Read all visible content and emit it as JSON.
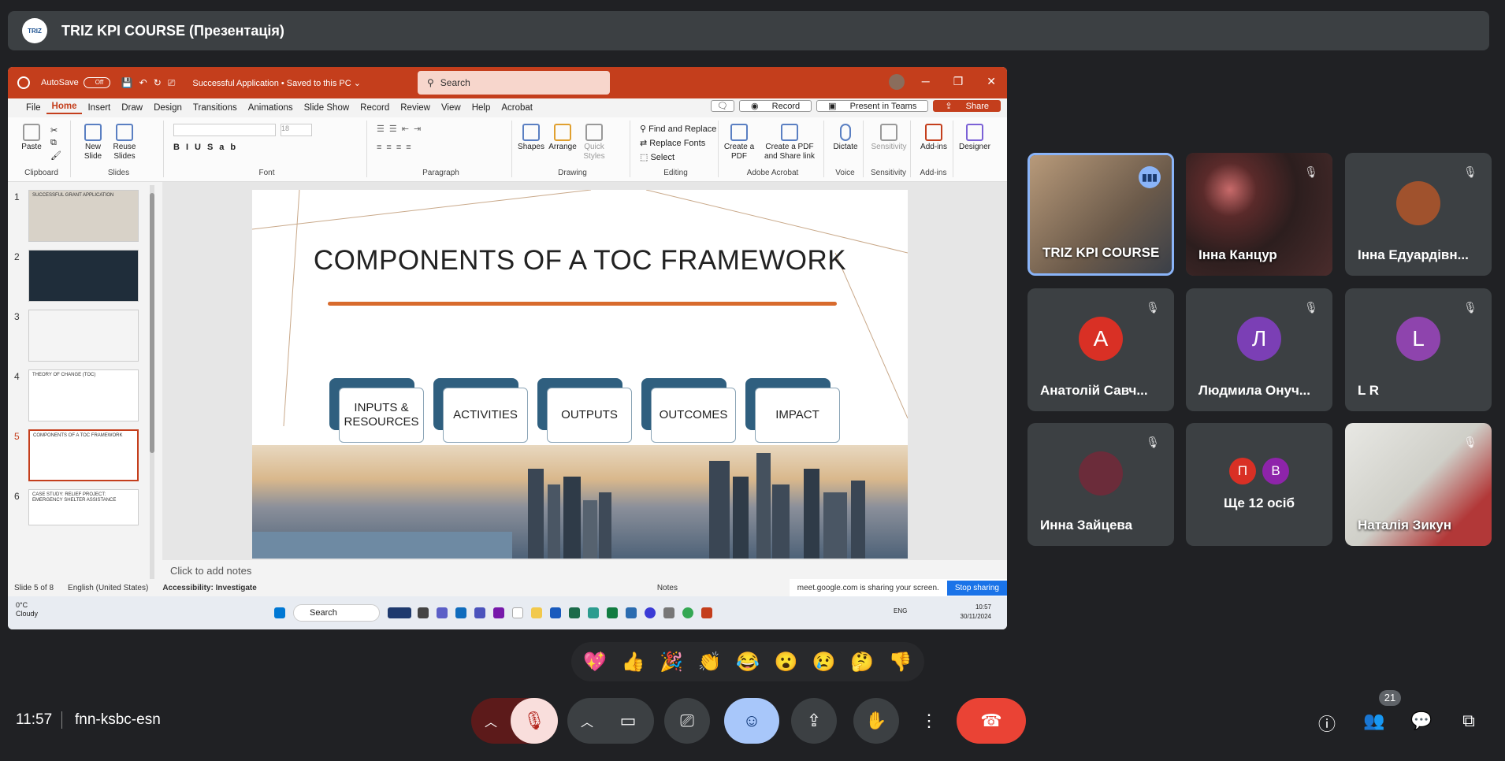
{
  "meeting": {
    "title": "TRIZ KPI COURSE (Презентація)",
    "logo_text": "TRIZ",
    "time": "11:57",
    "code": "fnn-ksbc-esn",
    "participant_count": "21"
  },
  "ppt": {
    "autosave_label": "AutoSave",
    "autosave_state": "Off",
    "doc_name": "Successful Application • Saved to this PC ⌄",
    "search_placeholder": "Search",
    "menu": [
      "File",
      "Home",
      "Insert",
      "Draw",
      "Design",
      "Transitions",
      "Animations",
      "Slide Show",
      "Record",
      "Review",
      "View",
      "Help",
      "Acrobat"
    ],
    "active_menu": "Home",
    "record_btn": "Record",
    "teams_btn": "Present in Teams",
    "share_btn": "Share",
    "ribbon": {
      "paste": "Paste",
      "clipboard": "Clipboard",
      "new_slide": "New Slide",
      "reuse_slides": "Reuse Slides",
      "slides": "Slides",
      "font": "Font",
      "paragraph": "Paragraph",
      "shapes": "Shapes",
      "arrange": "Arrange",
      "quick_styles": "Quick Styles",
      "drawing": "Drawing",
      "find_replace": "Find and Replace",
      "replace_fonts": "Replace Fonts",
      "select": "Select",
      "editing": "Editing",
      "create_pdf": "Create a PDF",
      "create_pdf_share": "Create a PDF and Share link",
      "adobe_acrobat": "Adobe Acrobat",
      "dictate": "Dictate",
      "voice": "Voice",
      "sensitivity_btn": "Sensitivity",
      "sensitivity": "Sensitivity",
      "addins_btn": "Add-ins",
      "addins": "Add-ins",
      "designer": "Designer"
    },
    "thumbnails": [
      {
        "num": "1",
        "text": "SUCCESSFUL GRANT APPLICATION"
      },
      {
        "num": "2",
        "text": ""
      },
      {
        "num": "3",
        "text": ""
      },
      {
        "num": "4",
        "text": "THEORY OF CHANGE (TOC)"
      },
      {
        "num": "5",
        "text": "COMPONENTS OF A TOC FRAMEWORK"
      },
      {
        "num": "6",
        "text": "CASE STUDY: RELIEF PROJECT: EMERGENCY SHELTER ASSISTANCE"
      }
    ],
    "selected_slide": "5",
    "slide": {
      "title": "COMPONENTS OF A TOC FRAMEWORK",
      "boxes": [
        "INPUTS & RESOURCES",
        "ACTIVITIES",
        "OUTPUTS",
        "OUTCOMES",
        "IMPACT"
      ]
    },
    "notes_placeholder": "Click to add notes",
    "status": {
      "slide_pos": "Slide 5 of 8",
      "language": "English (United States)",
      "accessibility": "Accessibility: Investigate",
      "notes": "Notes"
    },
    "sharing_text": "meet.google.com is sharing your screen.",
    "stop_sharing": "Stop sharing",
    "taskbar": {
      "weather_temp": "0°C",
      "weather_desc": "Cloudy",
      "search": "Search",
      "lang": "ENG",
      "time": "10:57",
      "date": "30/11/2024"
    }
  },
  "participants": [
    {
      "name": "TRIZ KPI COURSE",
      "type": "video",
      "speaking": true
    },
    {
      "name": "Інна Канцур",
      "type": "video",
      "muted": true
    },
    {
      "name": "Інна Едуардівн...",
      "type": "photo",
      "muted": true
    },
    {
      "name": "Анатолій Савч...",
      "type": "letter",
      "letter": "А",
      "color": "#d93025",
      "muted": true
    },
    {
      "name": "Людмила Онуч...",
      "type": "letter",
      "letter": "Л",
      "color": "#7b3fb5",
      "muted": true
    },
    {
      "name": "L R",
      "type": "letter",
      "letter": "L",
      "color": "#8e44ad",
      "muted": true
    },
    {
      "name": "Инна Зайцева",
      "type": "photo",
      "muted": true
    },
    {
      "name": "Ще 12 осіб",
      "type": "group",
      "letters": [
        "П",
        "В"
      ]
    },
    {
      "name": "Наталія Зикун",
      "type": "video",
      "muted": true
    }
  ],
  "reactions": [
    "💖",
    "👍",
    "🎉",
    "👏",
    "😂",
    "😮",
    "😢",
    "🤔",
    "👎"
  ],
  "colors": {
    "ppt_accent": "#c43e1c",
    "meet_bg": "#202124",
    "tile_bg": "#3c4043",
    "end_call": "#ea4335",
    "active_blue": "#a8c7fa"
  }
}
